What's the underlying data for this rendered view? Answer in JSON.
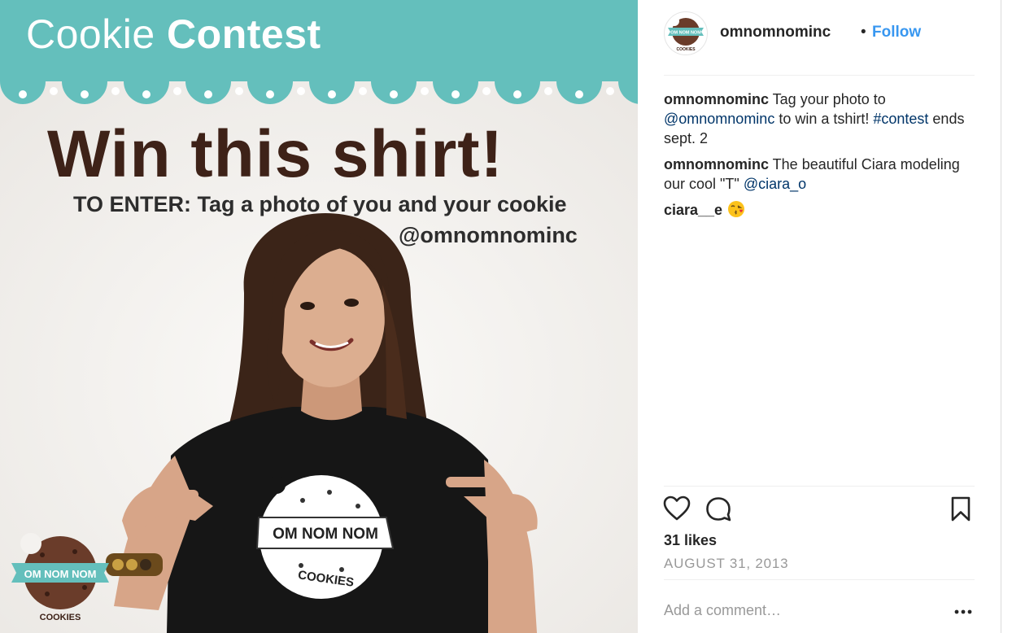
{
  "image": {
    "banner_light": "Cookie",
    "banner_bold": "Contest",
    "headline": "Win this shirt!",
    "enter_line": "TO ENTER: Tag a photo of you and your cookie",
    "enter_handle": "@omnomnominc",
    "shirt_logo_text": "OM NOM NOM",
    "shirt_logo_sub": "COOKIES",
    "corner_logo_text": "OM NOM NOM",
    "corner_logo_sub": "COOKIES",
    "colors": {
      "teal": "#64bfbc",
      "brown": "#3e2218"
    }
  },
  "header": {
    "avatar_text": "OM NOM NOM",
    "avatar_sub": "COOKIES",
    "username": "omnomnominc",
    "separator": "•",
    "follow_label": "Follow"
  },
  "comments": [
    {
      "user": "omnomnominc",
      "text1": " Tag your photo to ",
      "mention": "@omnomnominc",
      "text2": " to win a tshirt! ",
      "hashtag": "#contest",
      "text3": " ends sept. 2"
    },
    {
      "user": "omnomnominc",
      "text1": " The beautiful Ciara modeling our cool \"T\" ",
      "mention": "@ciara_o"
    },
    {
      "user": "ciara__e",
      "emoji": "kissing-face-emoji"
    }
  ],
  "actions": {
    "like_icon": "heart-icon",
    "comment_icon": "comment-bubble-icon",
    "save_icon": "bookmark-icon",
    "more_icon": "more-options-icon"
  },
  "likes": "31 likes",
  "date": "AUGUST 31, 2013",
  "comment_input": {
    "placeholder": "Add a comment…"
  },
  "colors": {
    "link_blue": "#3897f0",
    "mention_blue": "#003569",
    "muted": "#999999"
  }
}
